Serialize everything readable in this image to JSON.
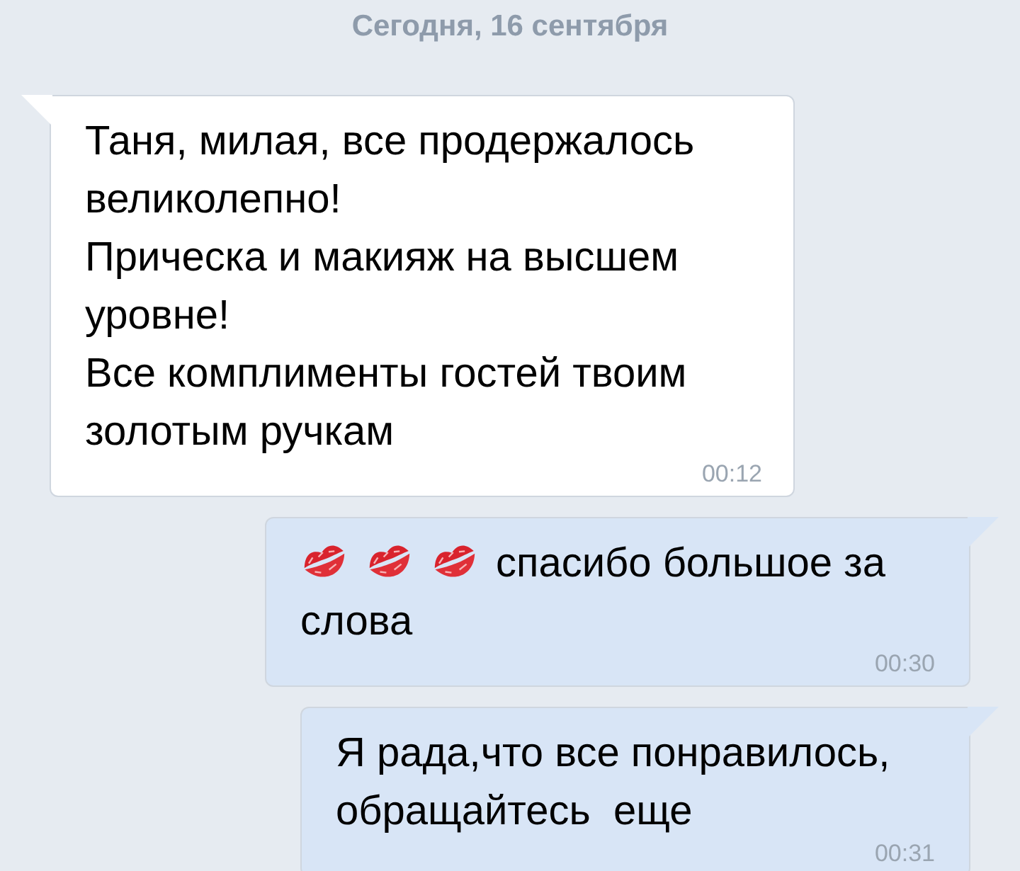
{
  "date_divider": "Сегодня, 16 сентября",
  "messages": [
    {
      "kind": "incoming",
      "text": "Таня, милая, все продержалось великолепно!\nПрическа и макияж на высшем уровне!\nВсе комплименты гостей твоим золотым ручкам",
      "time": "00:12"
    },
    {
      "kind": "outgoing",
      "icons": [
        {
          "kind": "kiss"
        },
        {
          "kind": "kiss"
        },
        {
          "kind": "kiss"
        }
      ],
      "text": "спасибо большое за слова",
      "time": "00:30"
    },
    {
      "kind": "outgoing",
      "text": "Я рада,что все понравилось, обращайтесь  еще",
      "time": "00:31"
    }
  ]
}
